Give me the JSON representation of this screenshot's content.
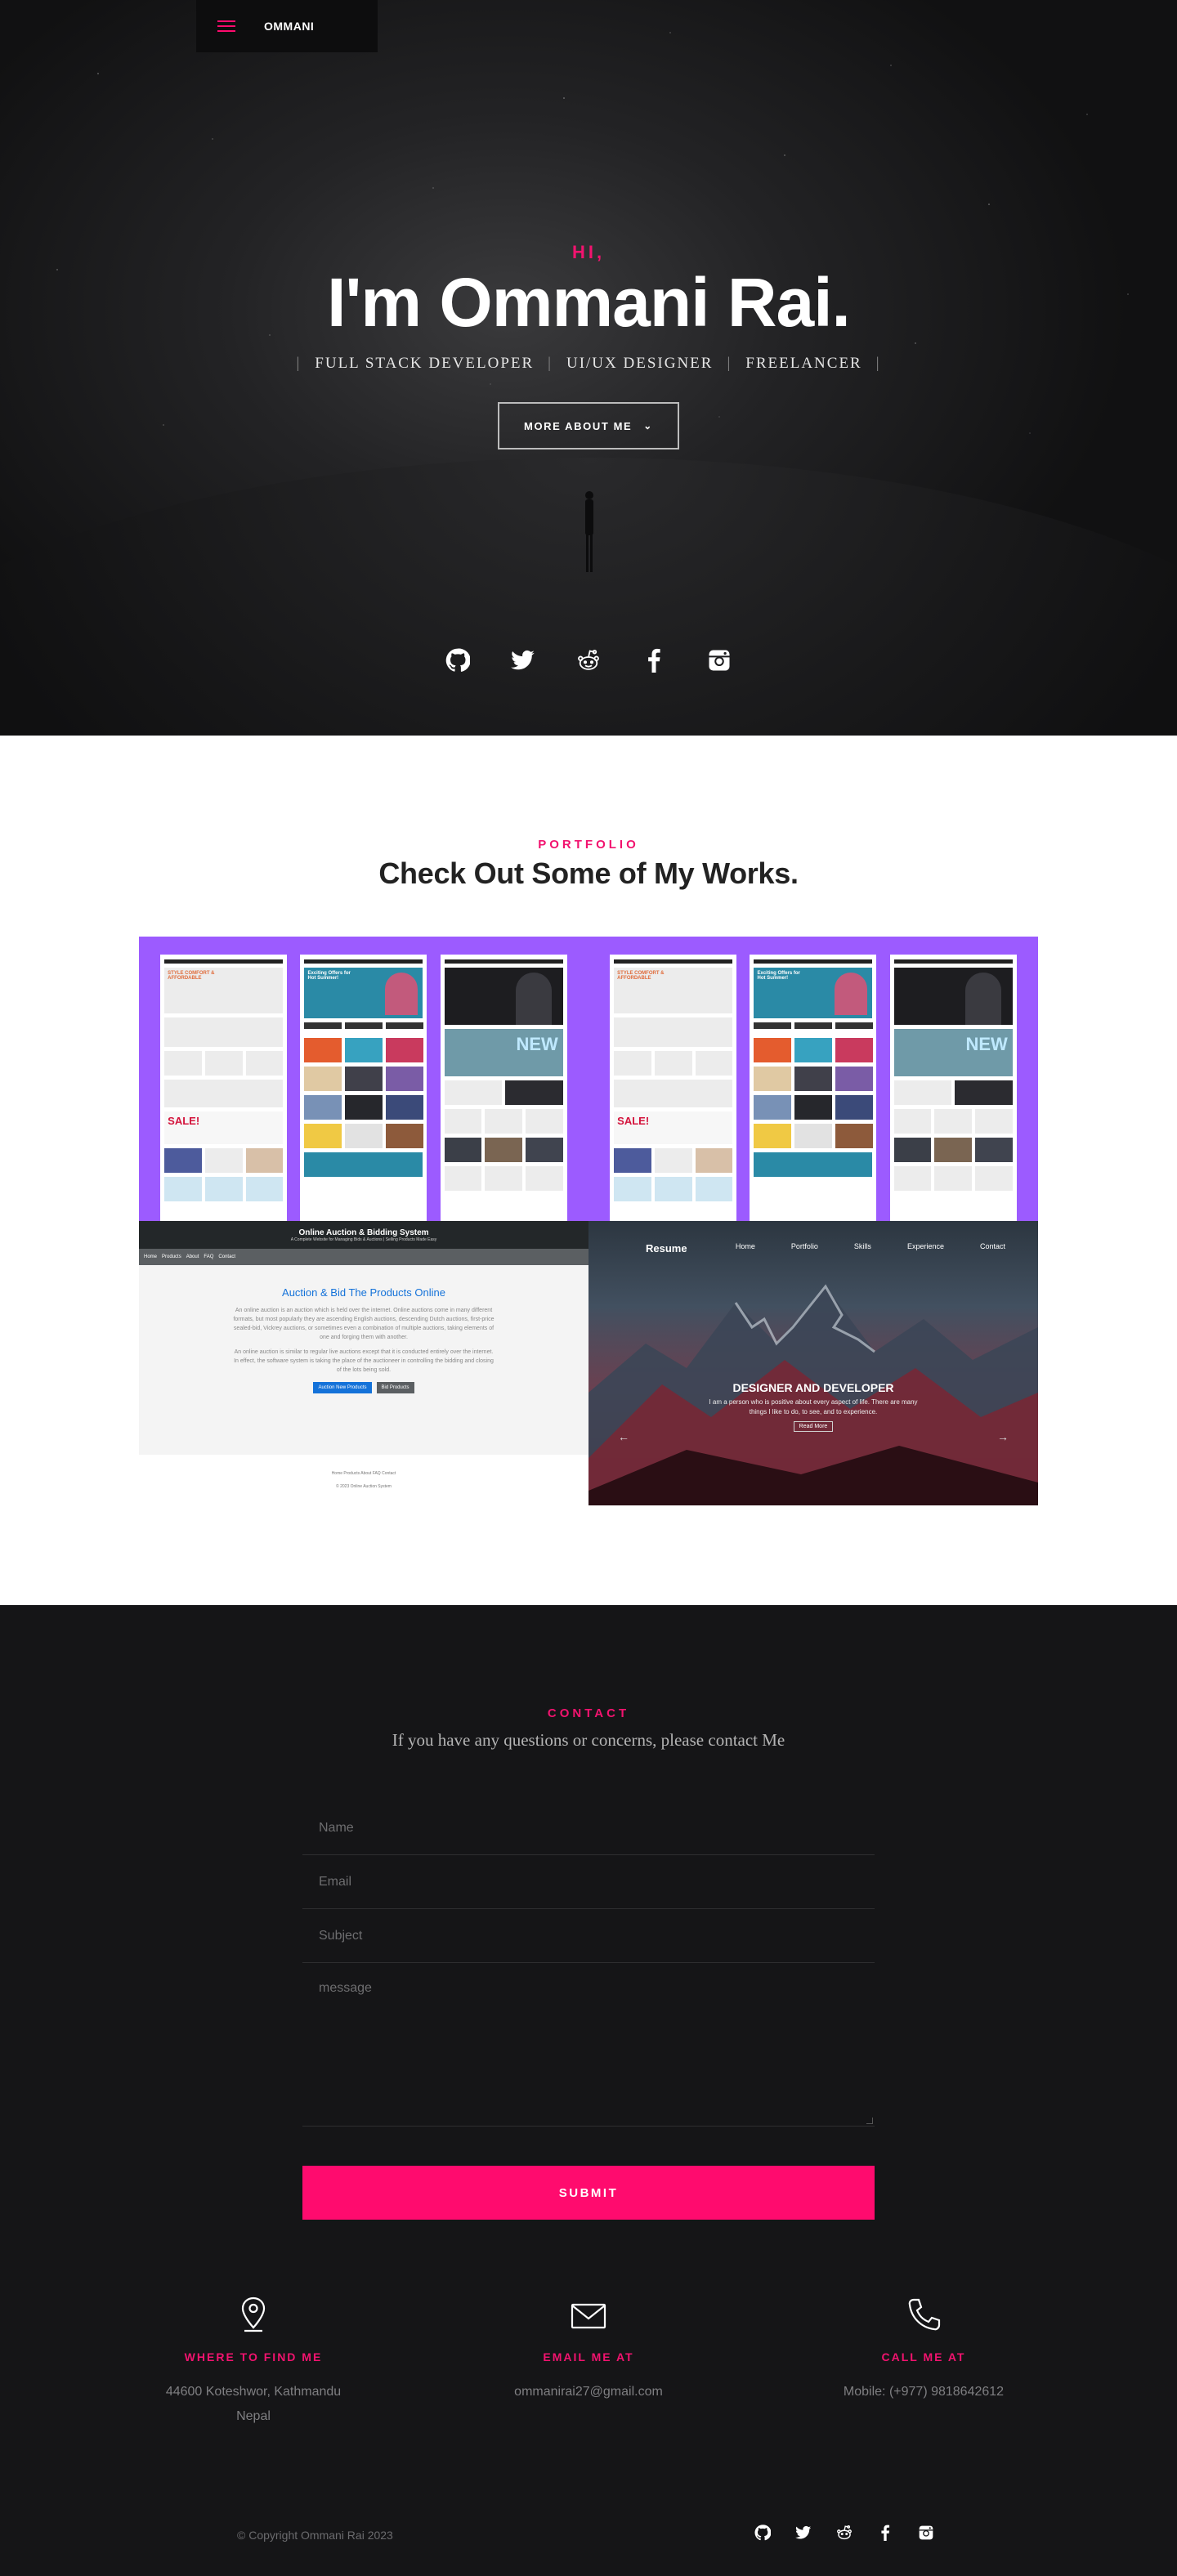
{
  "nav": {
    "logo": "OMMANI"
  },
  "hero": {
    "greeting": "HI,",
    "name": "I'm Ommani Rai.",
    "roles": [
      "FULL STACK DEVELOPER",
      "UI/UX DESIGNER",
      "FREELANCER"
    ],
    "cta": "MORE ABOUT ME",
    "social_icons": [
      "github-icon",
      "twitter-icon",
      "reddit-icon",
      "facebook-icon",
      "instagram-icon"
    ]
  },
  "portfolio": {
    "label": "PORTFOLIO",
    "title": "Check Out Some of My Works.",
    "shop": {
      "hero_text": "STYLE COMFORT & AFFORDABLE",
      "sale": "SALE!",
      "offers": "Exciting Offers for Hot Summer!",
      "brand": "NEW"
    },
    "auction": {
      "title": "Online Auction & Bidding System",
      "subtitle": "A Complete Website for Managing Bids & Auctions | Selling Products Made Easy",
      "nav": [
        "Home",
        "Products",
        "About",
        "FAQ",
        "Contact"
      ],
      "heading": "Auction & Bid The Products Online",
      "para1": "An online auction is an auction which is held over the internet. Online auctions come in many different formats, but most popularly they are ascending English auctions, descending Dutch auctions, first-price sealed-bid, Vickrey auctions, or sometimes even a combination of multiple auctions, taking elements of one and forging them with another.",
      "para2": "An online auction is similar to regular live auctions except that it is conducted entirely over the internet. In effect, the software system is taking the place of the auctioneer in controlling the bidding and closing of the lots being sold.",
      "btn1": "Auction New Products",
      "btn2": "Bid Products",
      "footer_links": "Home   Products   About   FAQ   Contact",
      "footer_copy": "© 2023 Online Auction System"
    },
    "resume": {
      "brand": "Resume",
      "nav": [
        "Home",
        "Portfolio",
        "Skills",
        "Experience",
        "Contact"
      ],
      "heading": "DESIGNER AND DEVELOPER",
      "text": "I am a person who is positive about every aspect of life. There are many things I like to do, to see, and to experience.",
      "button": "Read More"
    }
  },
  "contact": {
    "label": "CONTACT",
    "subtitle": "If you have any questions or concerns, please contact Me",
    "placeholders": {
      "name": "Name",
      "email": "Email",
      "subject": "Subject",
      "message": "message"
    },
    "submit": "SUBMIT",
    "info": [
      {
        "icon": "map-pin-icon",
        "title": "WHERE TO FIND ME",
        "lines": [
          "44600 Koteshwor, Kathmandu",
          "Nepal"
        ]
      },
      {
        "icon": "envelope-icon",
        "title": "EMAIL ME AT",
        "lines": [
          "ommanirai27@gmail.com"
        ]
      },
      {
        "icon": "phone-icon",
        "title": "CALL ME AT",
        "lines": [
          "Mobile: (+977) 9818642612"
        ]
      }
    ]
  },
  "footer": {
    "copyright": "© Copyright Ommani Rai 2023"
  },
  "colors": {
    "accent": "#ff0b6e",
    "dark": "#151517",
    "purple": "#9c5bff"
  }
}
